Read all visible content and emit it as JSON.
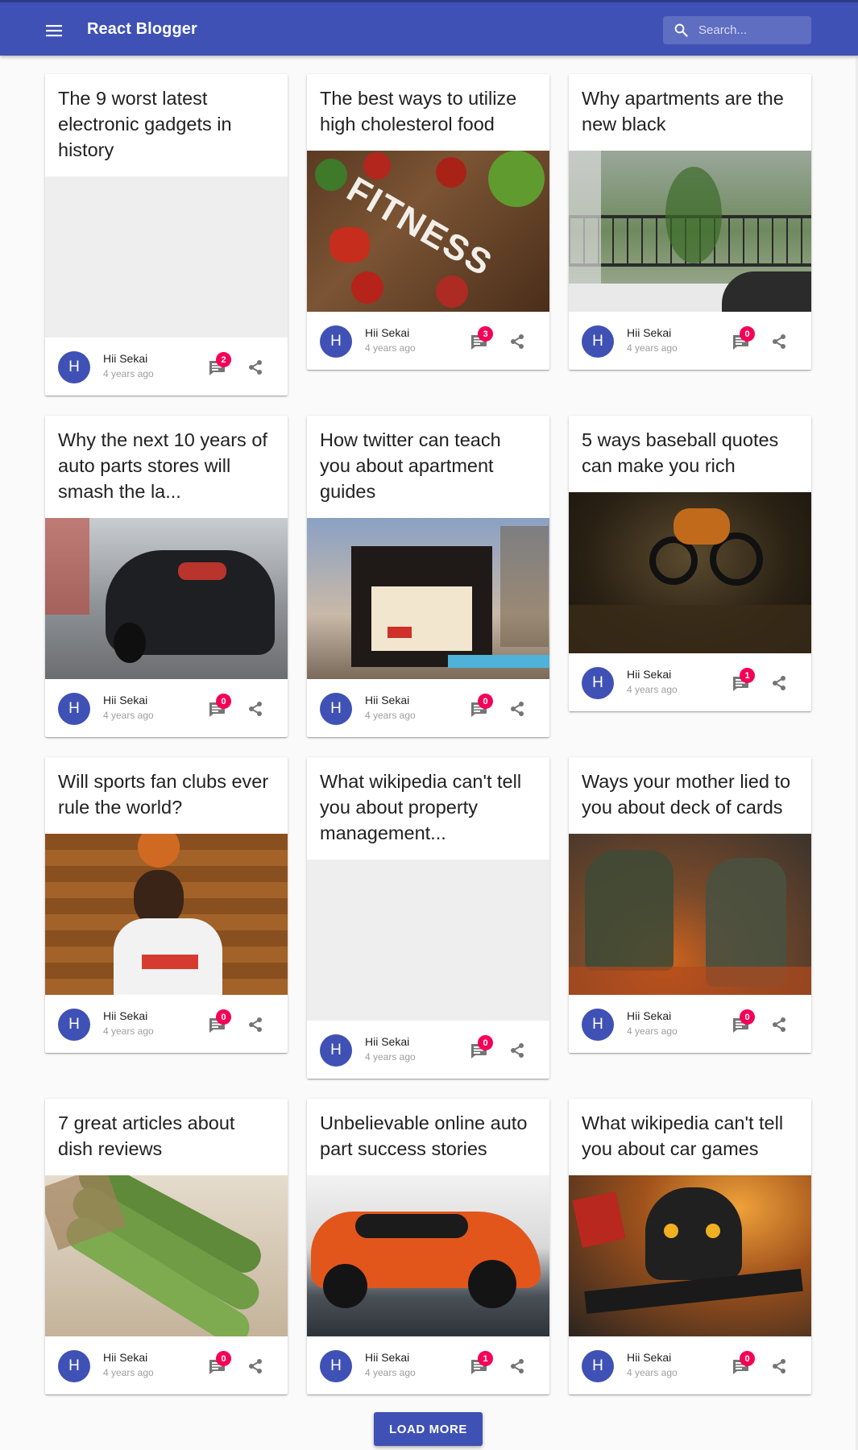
{
  "app": {
    "title": "React Blogger",
    "search_placeholder": "Search...",
    "menu_icon": "menu-icon",
    "search_icon": "search-icon",
    "brand_color": "#3f51b5",
    "badge_color": "#f50057"
  },
  "posts": [
    {
      "title": "The 9 worst latest electronic gadgets in history",
      "author": "Hii Sekai",
      "time": "4 years ago",
      "avatar": "H",
      "comments": "2"
    },
    {
      "title": "The best ways to utilize high cholesterol food",
      "author": "Hii Sekai",
      "time": "4 years ago",
      "avatar": "H",
      "comments": "3",
      "image_text": "FITNESS"
    },
    {
      "title": "Why apartments are the new black",
      "author": "Hii Sekai",
      "time": "4 years ago",
      "avatar": "H",
      "comments": "0"
    },
    {
      "title": "Why the next 10 years of auto parts stores will smash the la...",
      "author": "Hii Sekai",
      "time": "4 years ago",
      "avatar": "H",
      "comments": "0"
    },
    {
      "title": "How twitter can teach you about apartment guides",
      "author": "Hii Sekai",
      "time": "4 years ago",
      "avatar": "H",
      "comments": "0"
    },
    {
      "title": "5 ways baseball quotes can make you rich",
      "author": "Hii Sekai",
      "time": "4 years ago",
      "avatar": "H",
      "comments": "1"
    },
    {
      "title": "Will sports fan clubs ever rule the world?",
      "author": "Hii Sekai",
      "time": "4 years ago",
      "avatar": "H",
      "comments": "0"
    },
    {
      "title": "What wikipedia can't tell you about property management...",
      "author": "Hii Sekai",
      "time": "4 years ago",
      "avatar": "H",
      "comments": "0"
    },
    {
      "title": "Ways your mother lied to you about deck of cards",
      "author": "Hii Sekai",
      "time": "4 years ago",
      "avatar": "H",
      "comments": "0"
    },
    {
      "title": "7 great articles about dish reviews",
      "author": "Hii Sekai",
      "time": "4 years ago",
      "avatar": "H",
      "comments": "0"
    },
    {
      "title": "Unbelievable online auto part success stories",
      "author": "Hii Sekai",
      "time": "4 years ago",
      "avatar": "H",
      "comments": "1"
    },
    {
      "title": "What wikipedia can't tell you about car games",
      "author": "Hii Sekai",
      "time": "4 years ago",
      "avatar": "H",
      "comments": "0"
    }
  ],
  "load_more_label": "LOAD MORE"
}
